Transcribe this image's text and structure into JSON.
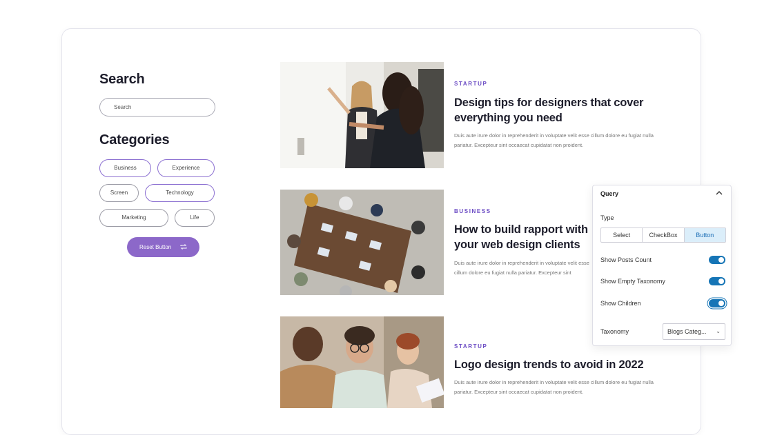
{
  "sidebar": {
    "search_heading": "Search",
    "search_placeholder": "Search",
    "categories_heading": "Categories",
    "categories": [
      "Business",
      "Experience",
      "Screen",
      "Technology",
      "Marketing",
      "Life"
    ],
    "reset_label": "Reset Button"
  },
  "posts": [
    {
      "category": "STARTUP",
      "title": "Design tips for designers that cover everything you need",
      "excerpt": "Duis aute irure dolor in reprehenderit in voluptate velit esse cillum dolore eu fugiat nulla pariatur. Excepteur sint occaecat cupidatat non proident."
    },
    {
      "category": "BUSINESS",
      "title": "How to build rapport with your web design clients",
      "excerpt": "Duis aute irure dolor in reprehenderit in voluptate velit esse cillum dolore eu fugiat nulla pariatur. Excepteur sint occaecat cupidatat non proident."
    },
    {
      "category": "STARTUP",
      "title": "Logo design trends to avoid in 2022",
      "excerpt": "Duis aute irure dolor in reprehenderit in voluptate velit esse cillum dolore eu fugiat nulla pariatur. Excepteur sint occaecat cupidatat non proident."
    }
  ],
  "panel": {
    "title": "Query",
    "type_label": "Type",
    "type_options": [
      "Select",
      "CheckBox",
      "Button"
    ],
    "type_selected": "Button",
    "toggles": [
      {
        "label": "Show Posts Count",
        "on": true
      },
      {
        "label": "Show Empty Taxonomy",
        "on": true
      },
      {
        "label": "Show Children",
        "on": true
      }
    ],
    "taxonomy_label": "Taxonomy",
    "taxonomy_value": "Blogs Categ..."
  },
  "colors": {
    "accent_purple": "#8c68c9",
    "category_purple": "#6b4bc4",
    "toggle_blue": "#1675b6"
  }
}
